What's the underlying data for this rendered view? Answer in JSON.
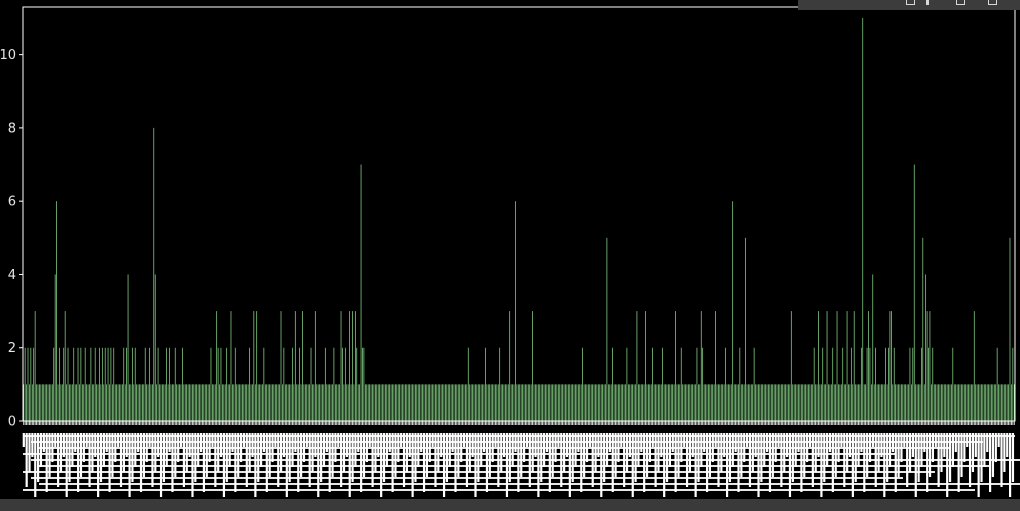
{
  "chart_data": {
    "type": "bar",
    "title": "",
    "xlabel": "",
    "ylabel": "",
    "ylim": [
      0,
      11.3
    ],
    "yticks": [
      "0",
      "2",
      "4",
      "6",
      "8",
      "10"
    ],
    "grid": false,
    "legend": "none",
    "bar_color": "#8fe08f",
    "axes_color": "#ffffff",
    "background": "#000000",
    "values": [
      1,
      2,
      1,
      2,
      1,
      2,
      1,
      2,
      3,
      1,
      1,
      1,
      1,
      1,
      1,
      1,
      1,
      1,
      1,
      1,
      1,
      2,
      4,
      6,
      1,
      2,
      1,
      1,
      2,
      3,
      1,
      2,
      1,
      1,
      1,
      2,
      1,
      1,
      2,
      1,
      2,
      1,
      1,
      2,
      1,
      1,
      1,
      2,
      1,
      1,
      2,
      1,
      1,
      2,
      1,
      2,
      1,
      2,
      1,
      2,
      1,
      2,
      1,
      2,
      1,
      1,
      1,
      1,
      1,
      1,
      2,
      1,
      2,
      4,
      1,
      1,
      2,
      1,
      2,
      1,
      1,
      1,
      1,
      1,
      1,
      2,
      1,
      1,
      2,
      1,
      1,
      8,
      4,
      1,
      2,
      1,
      1,
      1,
      1,
      1,
      2,
      1,
      2,
      1,
      1,
      1,
      2,
      1,
      1,
      1,
      1,
      2,
      1,
      1,
      1,
      1,
      1,
      1,
      1,
      1,
      1,
      1,
      1,
      1,
      1,
      1,
      1,
      1,
      1,
      1,
      1,
      2,
      1,
      1,
      1,
      3,
      2,
      1,
      2,
      1,
      1,
      1,
      2,
      1,
      1,
      3,
      1,
      1,
      2,
      1,
      1,
      1,
      1,
      1,
      1,
      1,
      1,
      1,
      2,
      1,
      1,
      3,
      1,
      3,
      1,
      1,
      1,
      1,
      2,
      1,
      1,
      1,
      1,
      1,
      1,
      1,
      1,
      1,
      1,
      1,
      3,
      1,
      2,
      1,
      1,
      1,
      1,
      1,
      2,
      1,
      3,
      1,
      1,
      2,
      1,
      3,
      1,
      1,
      1,
      1,
      1,
      2,
      1,
      1,
      3,
      1,
      1,
      1,
      1,
      1,
      1,
      2,
      1,
      1,
      1,
      1,
      1,
      2,
      1,
      1,
      1,
      1,
      3,
      2,
      1,
      2,
      1,
      1,
      3,
      1,
      3,
      1,
      3,
      2,
      1,
      1,
      7,
      2,
      2,
      1,
      1,
      1,
      1,
      1,
      1,
      1,
      1,
      1,
      1,
      1,
      1,
      1,
      1,
      1,
      1,
      1,
      1,
      1,
      1,
      1,
      1,
      1,
      1,
      1,
      1,
      1,
      1,
      1,
      1,
      1,
      1,
      1,
      1,
      1,
      1,
      1,
      1,
      1,
      1,
      1,
      1,
      1,
      1,
      1,
      1,
      1,
      1,
      1,
      1,
      1,
      1,
      1,
      1,
      1,
      1,
      1,
      1,
      1,
      1,
      1,
      1,
      1,
      1,
      1,
      1,
      1,
      1,
      1,
      1,
      1,
      1,
      2,
      1,
      1,
      1,
      1,
      1,
      1,
      1,
      1,
      1,
      1,
      1,
      2,
      1,
      1,
      1,
      1,
      1,
      1,
      1,
      1,
      1,
      2,
      1,
      1,
      1,
      1,
      1,
      1,
      3,
      1,
      1,
      1,
      6,
      1,
      1,
      1,
      1,
      1,
      1,
      1,
      1,
      1,
      1,
      1,
      3,
      1,
      1,
      1,
      1,
      1,
      1,
      1,
      1,
      1,
      1,
      1,
      1,
      1,
      1,
      1,
      1,
      1,
      1,
      1,
      1,
      1,
      1,
      1,
      1,
      1,
      1,
      1,
      1,
      1,
      1,
      1,
      1,
      1,
      1,
      2,
      1,
      1,
      1,
      1,
      1,
      1,
      1,
      1,
      1,
      1,
      1,
      1,
      1,
      1,
      1,
      1,
      5,
      1,
      1,
      1,
      2,
      1,
      1,
      1,
      1,
      1,
      1,
      1,
      1,
      1,
      2,
      1,
      1,
      1,
      1,
      1,
      1,
      3,
      1,
      1,
      1,
      1,
      1,
      3,
      1,
      1,
      1,
      1,
      2,
      1,
      1,
      1,
      1,
      1,
      1,
      2,
      1,
      1,
      1,
      1,
      1,
      1,
      1,
      1,
      3,
      1,
      1,
      1,
      2,
      1,
      1,
      1,
      1,
      1,
      1,
      1,
      1,
      1,
      1,
      2,
      1,
      1,
      3,
      2,
      1,
      1,
      1,
      1,
      1,
      1,
      1,
      1,
      3,
      1,
      1,
      1,
      1,
      1,
      1,
      2,
      1,
      1,
      1,
      1,
      6,
      1,
      1,
      1,
      1,
      2,
      1,
      1,
      1,
      5,
      1,
      1,
      1,
      1,
      1,
      2,
      1,
      1,
      1,
      1,
      1,
      1,
      1,
      1,
      1,
      1,
      1,
      1,
      1,
      1,
      1,
      1,
      1,
      1,
      1,
      1,
      1,
      1,
      1,
      1,
      1,
      3,
      1,
      1,
      1,
      1,
      1,
      1,
      1,
      1,
      1,
      1,
      1,
      1,
      1,
      1,
      1,
      2,
      1,
      1,
      3,
      1,
      1,
      2,
      1,
      1,
      3,
      1,
      1,
      1,
      2,
      1,
      1,
      3,
      1,
      1,
      1,
      2,
      1,
      1,
      3,
      1,
      1,
      2,
      1,
      3,
      1,
      1,
      1,
      1,
      2,
      11,
      1,
      1,
      2,
      3,
      2,
      1,
      4,
      1,
      2,
      1,
      1,
      1,
      1,
      1,
      1,
      2,
      1,
      2,
      3,
      3,
      1,
      2,
      1,
      1,
      1,
      1,
      1,
      1,
      1,
      1,
      1,
      1,
      2,
      1,
      2,
      7,
      1,
      1,
      1,
      1,
      2,
      5,
      1,
      4,
      3,
      2,
      3,
      1,
      2,
      1,
      1,
      1,
      1,
      1,
      1,
      1,
      1,
      1,
      1,
      1,
      1,
      1,
      2,
      1,
      1,
      1,
      1,
      1,
      1,
      1,
      1,
      1,
      1,
      1,
      1,
      1,
      1,
      3,
      1,
      1,
      1,
      1,
      1,
      1,
      1,
      1,
      1,
      1,
      1,
      1,
      1,
      1,
      1,
      2,
      1,
      1,
      1,
      1,
      1,
      1,
      1,
      1,
      5,
      1,
      2,
      1
    ]
  },
  "toolbar": {
    "icons": [
      "back-icon",
      "info-icon",
      "copy-icon",
      "delete-icon"
    ]
  }
}
